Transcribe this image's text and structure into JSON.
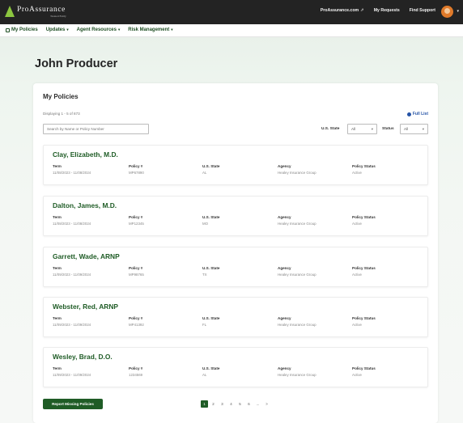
{
  "brand": {
    "name": "ProAssurance",
    "tagline": "Treated Fairly"
  },
  "topbar": {
    "links": [
      {
        "label": "ProAssurance.com",
        "icon": "external-link-icon"
      },
      {
        "label": "My Requests"
      },
      {
        "label": "Find Support"
      }
    ]
  },
  "nav": {
    "items": [
      {
        "label": "My Policies",
        "icon": "grid-icon"
      },
      {
        "label": "Updates",
        "icon": "chevron-down-icon"
      },
      {
        "label": "Agent Resources",
        "icon": "chevron-down-icon"
      },
      {
        "label": "Risk Management",
        "icon": "chevron-down-icon"
      }
    ]
  },
  "page": {
    "title": "John Producer"
  },
  "policies_card": {
    "title": "My Policies",
    "displaying": "Displaying 1 - 5 of 873",
    "full_list_label": "Full List",
    "search_placeholder": "Search by Name or Policy Number",
    "state_filter": {
      "label": "U.S. State",
      "value": "All"
    },
    "status_filter": {
      "label": "Status",
      "value": "All"
    }
  },
  "columns": {
    "term": "Term",
    "policy": "Policy #",
    "state": "U.S. State",
    "agency": "Agency",
    "status": "Policy Status"
  },
  "policies": [
    {
      "name": "Clay, Elizabeth, M.D.",
      "term": "11/08/2023 - 11/08/2024",
      "policy": "MP67890",
      "state": "AL",
      "agency": "Healey Insurance Group",
      "status": "Active"
    },
    {
      "name": "Dalton, James, M.D.",
      "term": "11/08/2023 - 11/08/2024",
      "policy": "MP12345",
      "state": "MO",
      "agency": "Healey Insurance Group",
      "status": "Active"
    },
    {
      "name": "Garrett, Wade, ARNP",
      "term": "11/09/2023 - 11/09/2024",
      "policy": "MP98765",
      "state": "TX",
      "agency": "Healey Insurance Group",
      "status": "Active"
    },
    {
      "name": "Webster, Red, ARNP",
      "term": "11/09/2023 - 11/09/2024",
      "policy": "MP41392",
      "state": "FL",
      "agency": "Healey Insurance Group",
      "status": "Active"
    },
    {
      "name": "Wesley, Brad, D.O.",
      "term": "11/09/2023 - 11/09/2024",
      "policy": "1234569",
      "state": "AL",
      "agency": "Healey Insurance Group",
      "status": "Active"
    }
  ],
  "footer": {
    "report_button": "Report Missing Policies",
    "pages": [
      "1",
      "2",
      "3",
      "4",
      "5",
      "6",
      "...",
      ">"
    ],
    "active_page": "1"
  },
  "colors": {
    "topbar": "#232323",
    "brand_green": "#1f5c26",
    "logo_green": "#8cc63f",
    "link_blue": "#2553a6"
  }
}
